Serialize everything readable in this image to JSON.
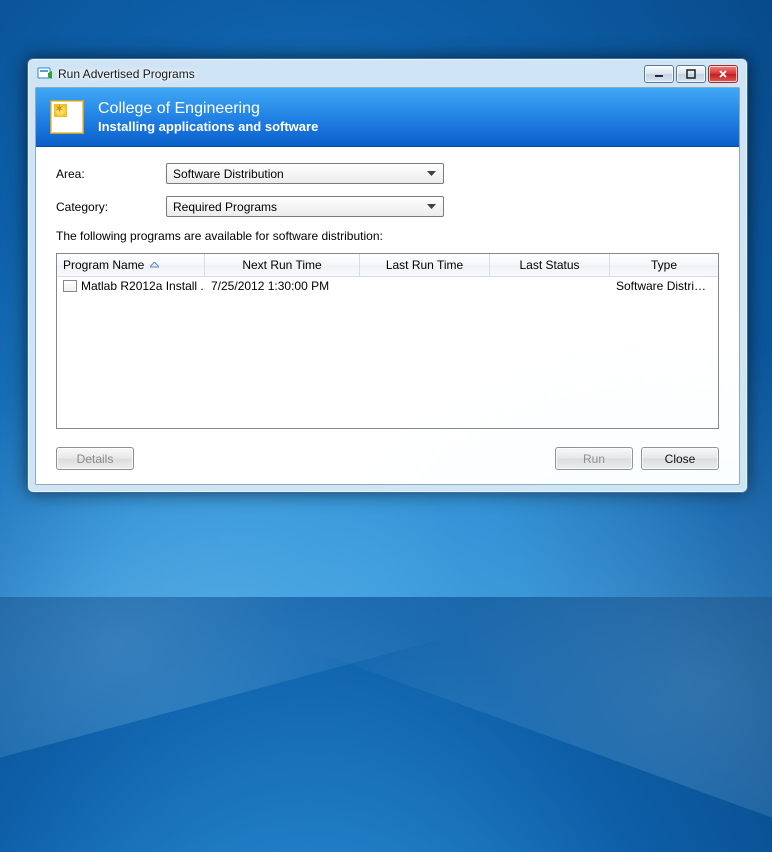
{
  "window": {
    "title": "Run Advertised Programs"
  },
  "banner": {
    "title": "College of Engineering",
    "subtitle": "Installing applications and software"
  },
  "form": {
    "area_label": "Area:",
    "area_value": "Software Distribution",
    "category_label": "Category:",
    "category_value": "Required Programs"
  },
  "instruction": "The following programs are available for software distribution:",
  "columns": {
    "program_name": "Program Name",
    "next_run": "Next Run Time",
    "last_run": "Last Run Time",
    "last_status": "Last Status",
    "type": "Type"
  },
  "rows": [
    {
      "name": "Matlab R2012a Install ...",
      "next_run": "7/25/2012 1:30:00 PM",
      "last_run": "",
      "last_status": "",
      "type": "Software Distribution"
    }
  ],
  "buttons": {
    "details": "Details",
    "run": "Run",
    "close": "Close"
  }
}
